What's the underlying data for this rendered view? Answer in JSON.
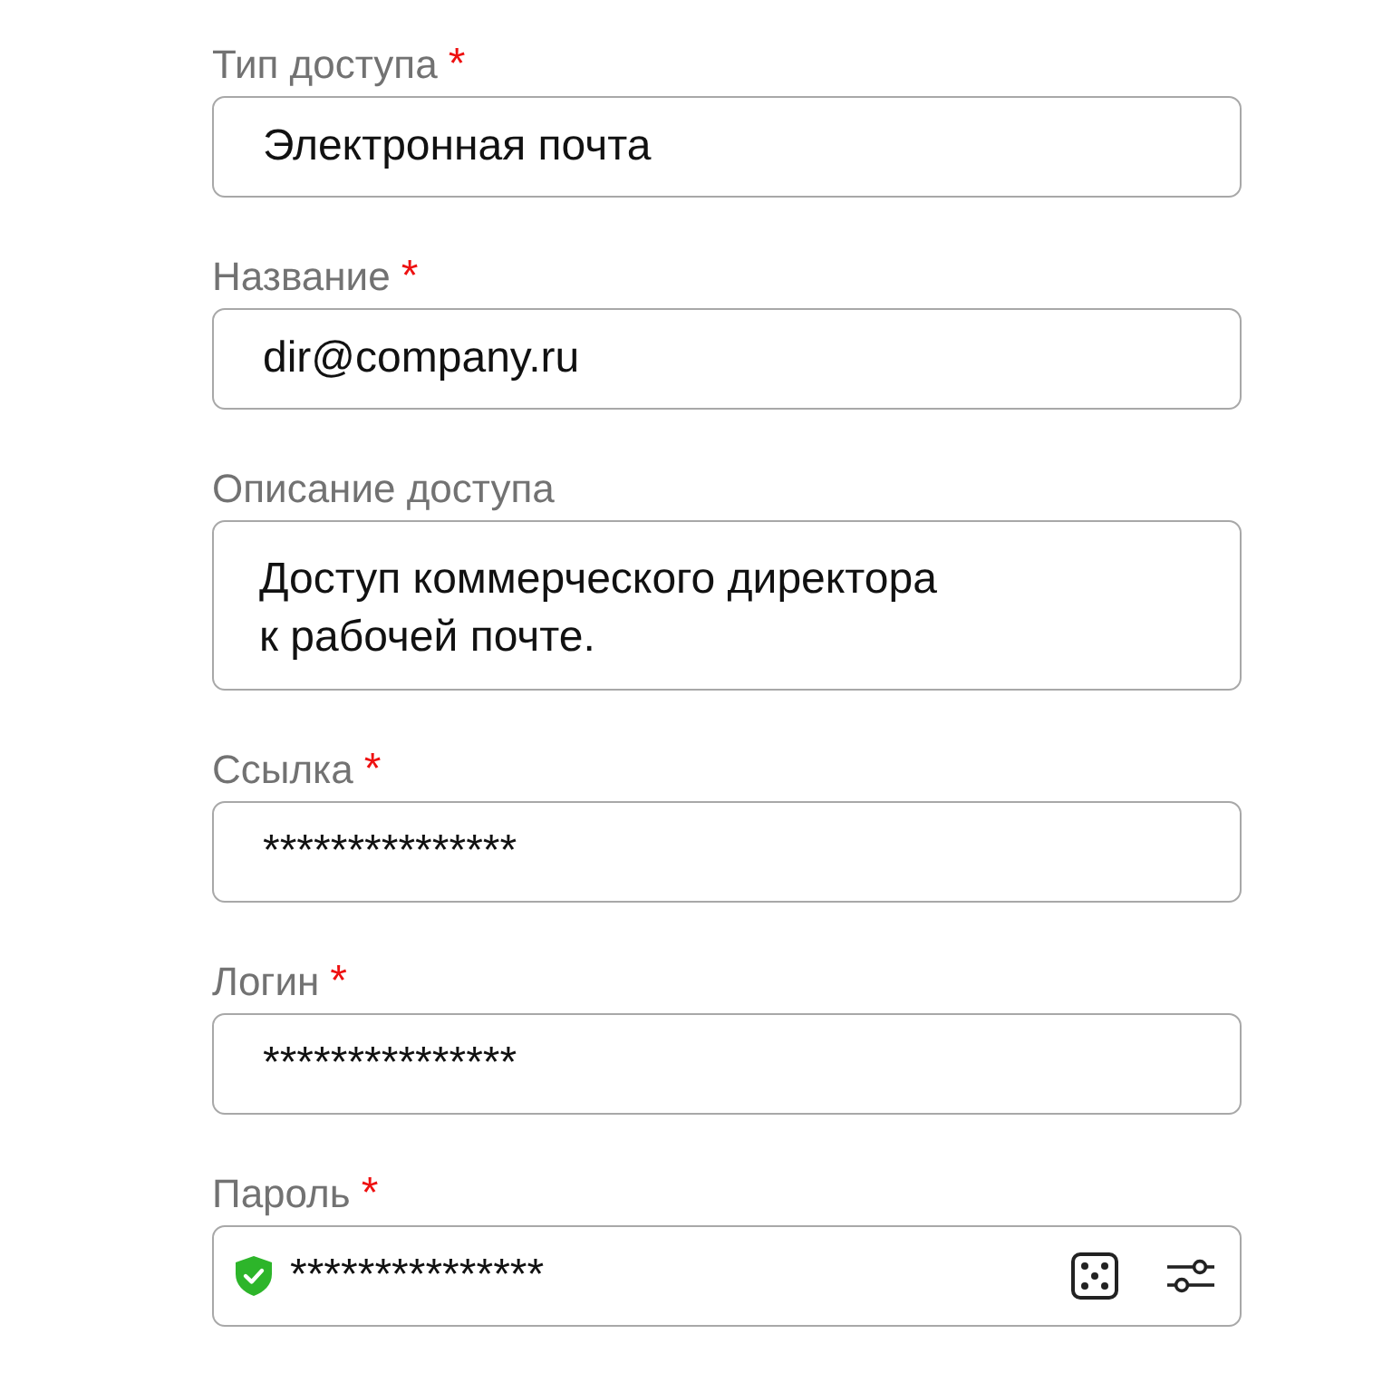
{
  "fields": [
    {
      "label": "Тип доступа",
      "required_mark": "*",
      "kind": "input",
      "value": "Электронная почта"
    },
    {
      "label": "Название",
      "required_mark": "*",
      "kind": "input",
      "value": "dir@company.ru"
    },
    {
      "label": "Описание доступа",
      "kind": "textarea",
      "value": "Доступ коммерческого директора\nк рабочей почте."
    },
    {
      "label": "Ссылка",
      "required_mark": "*",
      "kind": "input",
      "value": "***************"
    },
    {
      "label": "Логин",
      "required_mark": "*",
      "kind": "input",
      "value": "***************"
    },
    {
      "label": "Пароль",
      "required_mark": "*",
      "kind": "password",
      "value": "***************",
      "secure": true
    }
  ]
}
